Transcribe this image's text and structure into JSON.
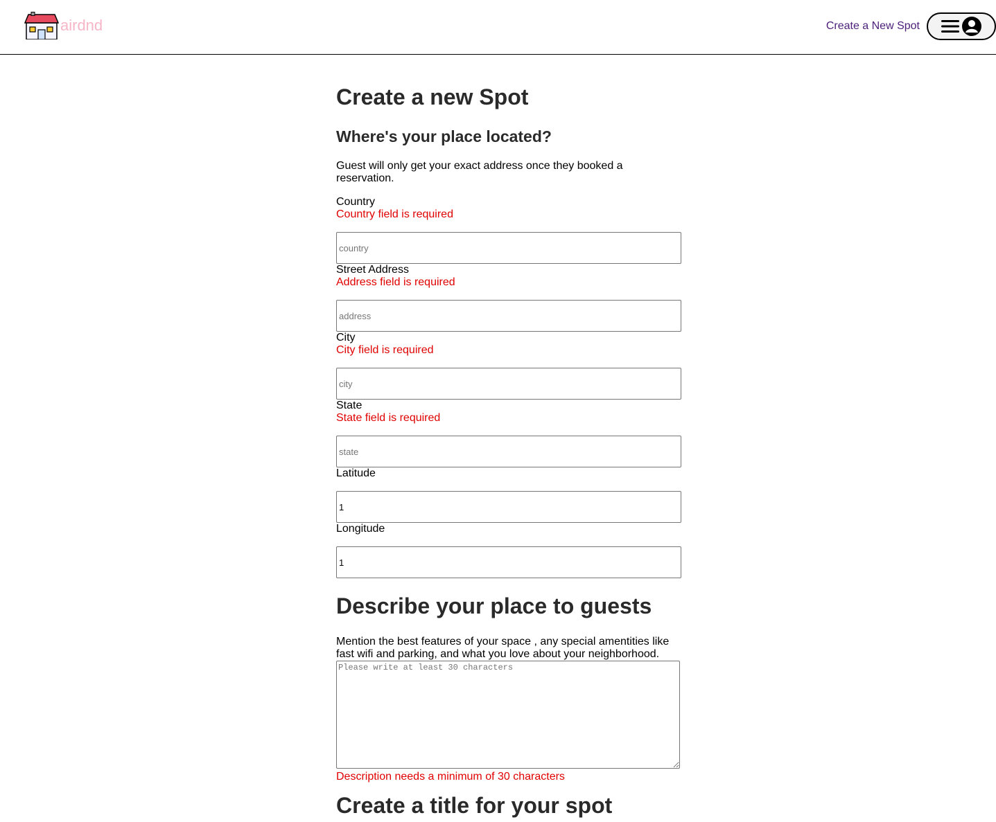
{
  "nav": {
    "logo_text": "airdnd",
    "create_link": "Create a New Spot",
    "menu_icon": "hamburger-icon",
    "user_icon": "user-circle-icon"
  },
  "form": {
    "title": "Create a new Spot",
    "location": {
      "heading": "Where's your place located?",
      "blurb": "Guest will only get your exact address once they booked a reservation.",
      "country": {
        "label": "Country",
        "error": "Country field is required",
        "placeholder": "country",
        "value": ""
      },
      "address": {
        "label": "Street Address",
        "error": "Address field is required",
        "placeholder": "address",
        "value": ""
      },
      "city": {
        "label": "City",
        "error": "City field is required",
        "placeholder": "city",
        "value": ""
      },
      "state": {
        "label": "State",
        "error": "State field is required",
        "placeholder": "state",
        "value": ""
      },
      "latitude": {
        "label": "Latitude",
        "value": "1"
      },
      "longitude": {
        "label": "Longitude",
        "value": "1"
      }
    },
    "description": {
      "heading": "Describe your place to guests",
      "blurb": "Mention the best features of your space , any special amentities like fast wifi and parking, and what you love about your neighborhood.",
      "placeholder": "Please write at least 30 characters",
      "error": "Description needs a minimum of 30 characters"
    },
    "title_section": {
      "heading": "Create a title for your spot"
    }
  },
  "colors": {
    "logo_text": "#f7b6c8",
    "nav_link": "#4b1e7a",
    "error": "#e00000",
    "heading": "#2a2a2a"
  }
}
